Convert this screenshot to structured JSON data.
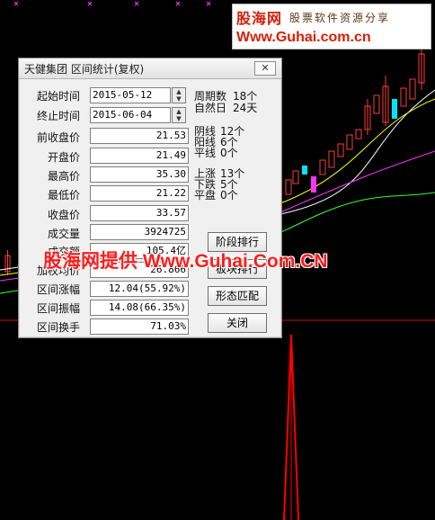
{
  "watermark_top": {
    "brand": "股海网",
    "slogan": "股票软件资源分享",
    "url": "Www.Guhai.com.cn"
  },
  "overlay_watermark": "股海网提供 Www.Guhai.Com.CN",
  "dialog": {
    "title": "天健集团 区间统计(复权)",
    "close_label": "✕",
    "fields": {
      "start_time": {
        "label": "起始时间",
        "value": "2015-05-12"
      },
      "end_time": {
        "label": "终止时间",
        "value": "2015-06-04"
      },
      "prev_close": {
        "label": "前收盘价",
        "value": "21.53"
      },
      "open": {
        "label": "开盘价",
        "value": "21.49"
      },
      "high": {
        "label": "最高价",
        "value": "35.30"
      },
      "low": {
        "label": "最低价",
        "value": "21.22"
      },
      "close": {
        "label": "收盘价",
        "value": "33.57"
      },
      "volume": {
        "label": "成交量",
        "value": "3924725"
      },
      "amount": {
        "label": "成交额",
        "value": "105.4亿"
      },
      "avg_price": {
        "label": "加权均价",
        "value": "26.866"
      },
      "range_change": {
        "label": "区间涨幅",
        "value": "12.04(55.92%)"
      },
      "range_amplitude": {
        "label": "区间振幅",
        "value": "14.08(66.35%)"
      },
      "turnover": {
        "label": "区间换手",
        "value": "71.03%"
      }
    },
    "stats": {
      "period_count": {
        "label": "周期数",
        "value": "18个"
      },
      "natural_days": {
        "label": "自然日",
        "value": "24天"
      },
      "yin_lines": {
        "label": "阴线",
        "value": "12个"
      },
      "yang_lines": {
        "label": "阳线",
        "value": "6个"
      },
      "flat_lines": {
        "label": "平线",
        "value": "0个"
      },
      "up_count": {
        "label": "上涨",
        "value": "13个"
      },
      "down_count": {
        "label": "下跌",
        "value": "5个"
      },
      "flat_count": {
        "label": "平盘",
        "value": "0个"
      }
    },
    "buttons": {
      "stage_rank": "阶段排行",
      "sector_rank": "板块排行",
      "pattern_match": "形态匹配",
      "close": "关闭"
    }
  },
  "colors": {
    "background": "#000000",
    "up_candle": "#ff3b3b",
    "down_candle": "#00e5ff",
    "ma_white": "#ffffff",
    "ma_yellow": "#ffff00",
    "ma_magenta": "#ff33ff",
    "ma_green": "#33ff33",
    "indicator_red": "#ff0000"
  }
}
